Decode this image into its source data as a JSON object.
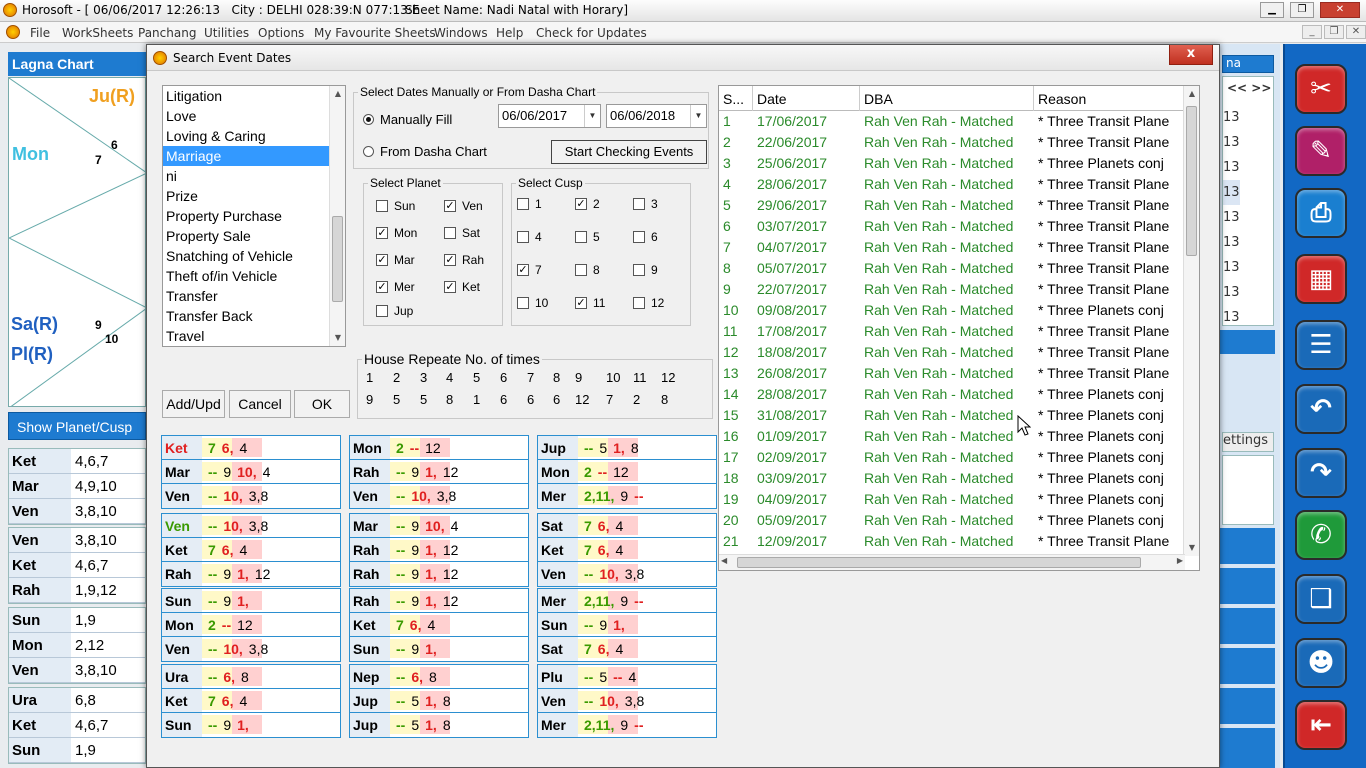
{
  "titlebar": {
    "title": "Horosoft - [ 06/06/2017 12:26:13   City : DELHI 028:39:N 077:13:E",
    "sheet": "Sheet Name: Nadi Natal with Horary]"
  },
  "menu": [
    "File",
    "WorkSheets",
    "Panchang",
    "Utilities",
    "Options",
    "My Favourite Sheets",
    "Windows",
    "Help",
    "Check for Updates"
  ],
  "left": {
    "title": "Lagna Chart",
    "chart": {
      "ju": "Ju(R)",
      "mon": "Mon",
      "n6": "6",
      "n7": "7",
      "sa": "Sa(R)",
      "pl": "Pl(R)",
      "n9": "9",
      "n10": "10"
    },
    "show_button": "Show Planet/Cusp",
    "groups": [
      [
        [
          "Ket",
          "4,6,7"
        ],
        [
          "Mar",
          "4,9,10"
        ],
        [
          "Ven",
          "3,8,10"
        ]
      ],
      [
        [
          "Ven",
          "3,8,10"
        ],
        [
          "Ket",
          "4,6,7"
        ],
        [
          "Rah",
          "1,9,12"
        ]
      ],
      [
        [
          "Sun",
          "1,9"
        ],
        [
          "Mon",
          "2,12"
        ],
        [
          "Ven",
          "3,8,10"
        ]
      ],
      [
        [
          "Ura",
          "6,8"
        ],
        [
          "Ket",
          "4,6,7"
        ],
        [
          "Sun",
          "1,9"
        ]
      ]
    ]
  },
  "bgright": {
    "nums": [
      "13",
      "13",
      "13",
      "13",
      "13",
      "13",
      "13",
      "13",
      "13",
      "13"
    ],
    "top_label": "na",
    "nav": "<< >>",
    "settings": "ettings"
  },
  "dialog": {
    "title": "Search Event Dates",
    "close": "x",
    "events": [
      "Litigation",
      "Love",
      "Loving & Caring",
      "Marriage",
      "ni",
      "Prize",
      "Property Purchase",
      "Property Sale",
      "Snatching of Vehicle",
      "Theft of/in Vehicle",
      "Transfer",
      "Transfer Back",
      "Travel"
    ],
    "selected_event": "Marriage",
    "buttons": {
      "add": "Add/Upd",
      "cancel": "Cancel",
      "ok": "OK",
      "start": "Start Checking Events"
    },
    "dates_group": "Select Dates Manually or From Dasha Chart",
    "manual": "Manually Fill",
    "dasha": "From Dasha Chart",
    "date_from": "06/06/2017",
    "date_to": "06/06/2018",
    "planet_group": "Select Planet",
    "planets": [
      [
        "Sun",
        false
      ],
      [
        "Ven",
        true
      ],
      [
        "Mon",
        true
      ],
      [
        "Sat",
        false
      ],
      [
        "Mar",
        true
      ],
      [
        "Rah",
        true
      ],
      [
        "Mer",
        true
      ],
      [
        "Ket",
        true
      ],
      [
        "Jup",
        false
      ]
    ],
    "cusp_group": "Select Cusp",
    "cusps": [
      [
        "1",
        false
      ],
      [
        "2",
        true
      ],
      [
        "3",
        false
      ],
      [
        "4",
        false
      ],
      [
        "5",
        false
      ],
      [
        "6",
        false
      ],
      [
        "7",
        true
      ],
      [
        "8",
        false
      ],
      [
        "9",
        false
      ],
      [
        "10",
        false
      ],
      [
        "11",
        true
      ],
      [
        "12",
        false
      ]
    ],
    "house_group": "House Repeate No. of times",
    "houses": [
      "1",
      "2",
      "3",
      "4",
      "5",
      "6",
      "7",
      "8",
      "9",
      "10",
      "11",
      "12"
    ],
    "times": [
      "9",
      "5",
      "5",
      "8",
      "1",
      "6",
      "6",
      "6",
      "12",
      "7",
      "2",
      "8"
    ],
    "results": {
      "headers": [
        "S...",
        "Date",
        "DBA",
        "Reason"
      ],
      "rows": [
        [
          "1",
          "17/06/2017",
          "Rah Ven Rah - Matched",
          "* Three Transit Plane"
        ],
        [
          "2",
          "22/06/2017",
          "Rah Ven Rah - Matched",
          "* Three Transit Plane"
        ],
        [
          "3",
          "25/06/2017",
          "Rah Ven Rah - Matched",
          "* Three Planets conj"
        ],
        [
          "4",
          "28/06/2017",
          "Rah Ven Rah - Matched",
          "* Three Transit Plane"
        ],
        [
          "5",
          "29/06/2017",
          "Rah Ven Rah - Matched",
          "* Three Transit Plane"
        ],
        [
          "6",
          "03/07/2017",
          "Rah Ven Rah - Matched",
          "* Three Transit Plane"
        ],
        [
          "7",
          "04/07/2017",
          "Rah Ven Rah - Matched",
          "* Three Transit Plane"
        ],
        [
          "8",
          "05/07/2017",
          "Rah Ven Rah - Matched",
          "* Three Transit Plane"
        ],
        [
          "9",
          "22/07/2017",
          "Rah Ven Rah - Matched",
          "* Three Transit Plane"
        ],
        [
          "10",
          "09/08/2017",
          "Rah Ven Rah - Matched",
          "* Three Planets conj"
        ],
        [
          "11",
          "17/08/2017",
          "Rah Ven Rah - Matched",
          "* Three Transit Plane"
        ],
        [
          "12",
          "18/08/2017",
          "Rah Ven Rah - Matched",
          "* Three Transit Plane"
        ],
        [
          "13",
          "26/08/2017",
          "Rah Ven Rah - Matched",
          "* Three Transit Plane"
        ],
        [
          "14",
          "28/08/2017",
          "Rah Ven Rah - Matched",
          "* Three Planets conj"
        ],
        [
          "15",
          "31/08/2017",
          "Rah Ven Rah - Matched",
          "* Three Planets conj"
        ],
        [
          "16",
          "01/09/2017",
          "Rah Ven Rah - Matched",
          "* Three Planets conj"
        ],
        [
          "17",
          "02/09/2017",
          "Rah Ven Rah - Matched",
          "* Three Planets conj"
        ],
        [
          "18",
          "03/09/2017",
          "Rah Ven Rah - Matched",
          "* Three Planets conj"
        ],
        [
          "19",
          "04/09/2017",
          "Rah Ven Rah - Matched",
          "* Three Planets conj"
        ],
        [
          "20",
          "05/09/2017",
          "Rah Ven Rah - Matched",
          "* Three Planets conj"
        ],
        [
          "21",
          "12/09/2017",
          "Rah Ven Rah - Matched",
          "* Three Transit Plane"
        ]
      ]
    },
    "planet_tables": [
      [
        [
          [
            "Ket",
            "r"
          ],
          [
            "7",
            "g"
          ],
          [
            "6,",
            "r"
          ],
          [
            "4",
            "n"
          ]
        ],
        [
          [
            "Mar",
            "n"
          ],
          [
            "--",
            "g"
          ],
          [
            "9",
            "n"
          ],
          [
            "10,",
            "r"
          ],
          [
            "4",
            "n"
          ]
        ],
        [
          [
            "Ven",
            "n"
          ],
          [
            "--",
            "g"
          ],
          [
            "10,",
            "r"
          ],
          [
            "3,8",
            "n"
          ]
        ]
      ],
      [
        [
          [
            "Mon",
            "n"
          ],
          [
            "2",
            "g"
          ],
          [
            "--",
            "r"
          ],
          [
            "12",
            "n"
          ]
        ],
        [
          [
            "Rah",
            "n"
          ],
          [
            "--",
            "g"
          ],
          [
            "9",
            "n"
          ],
          [
            "1,",
            "r"
          ],
          [
            "12",
            "n"
          ]
        ],
        [
          [
            "Ven",
            "n"
          ],
          [
            "--",
            "g"
          ],
          [
            "10,",
            "r"
          ],
          [
            "3,8",
            "n"
          ]
        ]
      ],
      [
        [
          [
            "Jup",
            "n"
          ],
          [
            "--",
            "g"
          ],
          [
            "5",
            "n"
          ],
          [
            "1,",
            "r"
          ],
          [
            "8",
            "n"
          ]
        ],
        [
          [
            "Mon",
            "n"
          ],
          [
            "2",
            "g"
          ],
          [
            "--",
            "r"
          ],
          [
            "12",
            "n"
          ]
        ],
        [
          [
            "Mer",
            "n"
          ],
          [
            "2,11,",
            "g"
          ],
          [
            "9",
            "n"
          ],
          [
            "--",
            "r"
          ]
        ]
      ],
      [
        [
          [
            "Ven",
            "g"
          ],
          [
            "--",
            "g"
          ],
          [
            "10,",
            "r"
          ],
          [
            "3,8",
            "n"
          ]
        ],
        [
          [
            "Ket",
            "n"
          ],
          [
            "7",
            "g"
          ],
          [
            "6,",
            "r"
          ],
          [
            "4",
            "n"
          ]
        ],
        [
          [
            "Rah",
            "n"
          ],
          [
            "--",
            "g"
          ],
          [
            "9",
            "n"
          ],
          [
            "1,",
            "r"
          ],
          [
            "12",
            "n"
          ]
        ]
      ],
      [
        [
          [
            "Mar",
            "n"
          ],
          [
            "--",
            "g"
          ],
          [
            "9",
            "n"
          ],
          [
            "10,",
            "r"
          ],
          [
            "4",
            "n"
          ]
        ],
        [
          [
            "Rah",
            "n"
          ],
          [
            "--",
            "g"
          ],
          [
            "9",
            "n"
          ],
          [
            "1,",
            "r"
          ],
          [
            "12",
            "n"
          ]
        ],
        [
          [
            "Rah",
            "n"
          ],
          [
            "--",
            "g"
          ],
          [
            "9",
            "n"
          ],
          [
            "1,",
            "r"
          ],
          [
            "12",
            "n"
          ]
        ]
      ],
      [
        [
          [
            "Sat",
            "n"
          ],
          [
            "7",
            "g"
          ],
          [
            "6,",
            "r"
          ],
          [
            "4",
            "n"
          ]
        ],
        [
          [
            "Ket",
            "n"
          ],
          [
            "7",
            "g"
          ],
          [
            "6,",
            "r"
          ],
          [
            "4",
            "n"
          ]
        ],
        [
          [
            "Ven",
            "n"
          ],
          [
            "--",
            "g"
          ],
          [
            "10,",
            "r"
          ],
          [
            "3,8",
            "n"
          ]
        ]
      ],
      [
        [
          [
            "Sun",
            "n"
          ],
          [
            "--",
            "g"
          ],
          [
            "9",
            "n"
          ],
          [
            "1,",
            "r"
          ]
        ],
        [
          [
            "Mon",
            "n"
          ],
          [
            "2",
            "g"
          ],
          [
            "--",
            "r"
          ],
          [
            "12",
            "n"
          ]
        ],
        [
          [
            "Ven",
            "n"
          ],
          [
            "--",
            "g"
          ],
          [
            "10,",
            "r"
          ],
          [
            "3,8",
            "n"
          ]
        ]
      ],
      [
        [
          [
            "Rah",
            "n"
          ],
          [
            "--",
            "g"
          ],
          [
            "9",
            "n"
          ],
          [
            "1,",
            "r"
          ],
          [
            "12",
            "n"
          ]
        ],
        [
          [
            "Ket",
            "n"
          ],
          [
            "7",
            "g"
          ],
          [
            "6,",
            "r"
          ],
          [
            "4",
            "n"
          ]
        ],
        [
          [
            "Sun",
            "n"
          ],
          [
            "--",
            "g"
          ],
          [
            "9",
            "n"
          ],
          [
            "1,",
            "r"
          ]
        ]
      ],
      [
        [
          [
            "Mer",
            "n"
          ],
          [
            "2,11,",
            "g"
          ],
          [
            "9",
            "n"
          ],
          [
            "--",
            "r"
          ]
        ],
        [
          [
            "Sun",
            "n"
          ],
          [
            "--",
            "g"
          ],
          [
            "9",
            "n"
          ],
          [
            "1,",
            "r"
          ]
        ],
        [
          [
            "Sat",
            "n"
          ],
          [
            "7",
            "g"
          ],
          [
            "6,",
            "r"
          ],
          [
            "4",
            "n"
          ]
        ]
      ],
      [
        [
          [
            "Ura",
            "n"
          ],
          [
            "--",
            "g"
          ],
          [
            "6,",
            "r"
          ],
          [
            "8",
            "n"
          ]
        ],
        [
          [
            "Ket",
            "n"
          ],
          [
            "7",
            "g"
          ],
          [
            "6,",
            "r"
          ],
          [
            "4",
            "n"
          ]
        ],
        [
          [
            "Sun",
            "n"
          ],
          [
            "--",
            "g"
          ],
          [
            "9",
            "n"
          ],
          [
            "1,",
            "r"
          ]
        ]
      ],
      [
        [
          [
            "Nep",
            "n"
          ],
          [
            "--",
            "g"
          ],
          [
            "6,",
            "r"
          ],
          [
            "8",
            "n"
          ]
        ],
        [
          [
            "Jup",
            "n"
          ],
          [
            "--",
            "g"
          ],
          [
            "5",
            "n"
          ],
          [
            "1,",
            "r"
          ],
          [
            "8",
            "n"
          ]
        ],
        [
          [
            "Jup",
            "n"
          ],
          [
            "--",
            "g"
          ],
          [
            "5",
            "n"
          ],
          [
            "1,",
            "r"
          ],
          [
            "8",
            "n"
          ]
        ]
      ],
      [
        [
          [
            "Plu",
            "n"
          ],
          [
            "--",
            "g"
          ],
          [
            "5",
            "n"
          ],
          [
            "--",
            "r"
          ],
          [
            "4",
            "n"
          ]
        ],
        [
          [
            "Ven",
            "n"
          ],
          [
            "--",
            "g"
          ],
          [
            "10,",
            "r"
          ],
          [
            "3,8",
            "n"
          ]
        ],
        [
          [
            "Mer",
            "n"
          ],
          [
            "2,11,",
            "g"
          ],
          [
            "9",
            "n"
          ],
          [
            "--",
            "r"
          ]
        ]
      ]
    ]
  },
  "toolbar_icons": [
    "tools-icon",
    "edit-icon",
    "print-icon",
    "calendar-icon",
    "document-icon",
    "back-arrow-icon",
    "forward-arrow-icon",
    "whatsapp-icon",
    "book-icon",
    "people-icon",
    "exit-icon"
  ],
  "colors": {
    "accent": "#1e7bd0",
    "matched": "#2a8a2a",
    "selected": "#3399ff"
  }
}
